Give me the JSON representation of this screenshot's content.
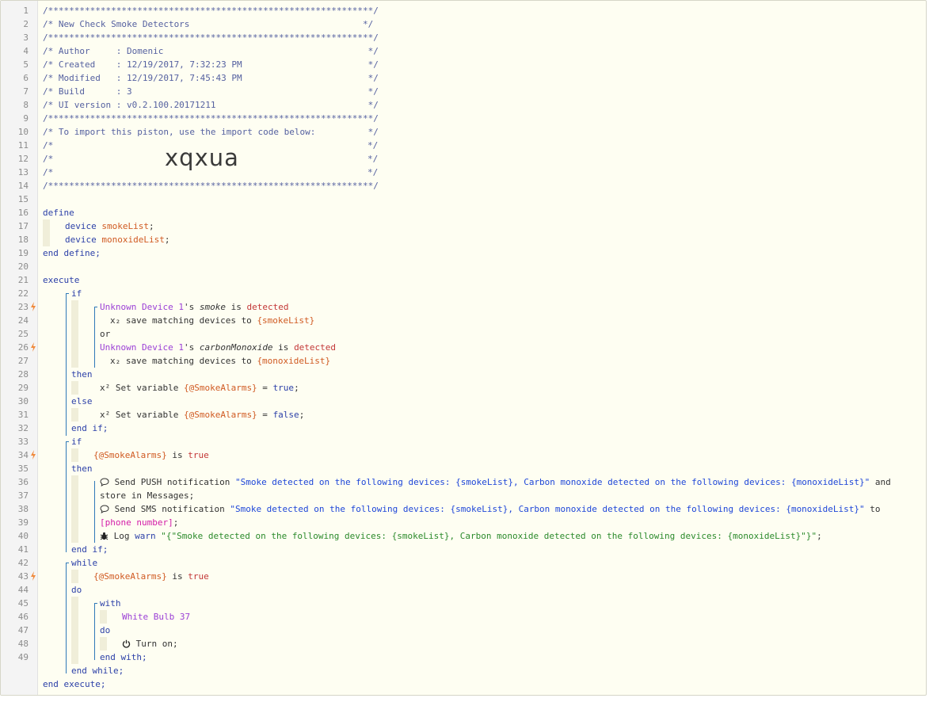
{
  "header": {
    "border_line": "/**************************************************************/",
    "title_line": "/* New Check Smoke Detectors                                 */",
    "author_line": "/* Author     : Domenic                                       */",
    "created_line": "/* Created    : 12/19/2017, 7:32:23 PM                        */",
    "modified_line": "/* Modified   : 12/19/2017, 7:45:43 PM                        */",
    "build_line": "/* Build      : 3                                             */",
    "version_line": "/* UI version : v0.2.100.20171211                             */",
    "import_line": "/* To import this piston, use the import code below:          */",
    "blank_comment_left": "/*",
    "blank_comment_right": "*/",
    "import_code": "xqxua"
  },
  "line_numbers": [
    "1",
    "2",
    "3",
    "4",
    "5",
    "6",
    "7",
    "8",
    "9",
    "10",
    "11",
    "12",
    "13",
    "14",
    "15",
    "16",
    "17",
    "18",
    "19",
    "20",
    "21",
    "22",
    "23",
    "24",
    "25",
    "26",
    "27",
    "28",
    "29",
    "30",
    "31",
    "32",
    "33",
    "34",
    "35",
    "36",
    "37",
    "38",
    "39",
    "40",
    "41",
    "42",
    "43",
    "44",
    "45",
    "46",
    "47",
    "48",
    "49"
  ],
  "code": {
    "define": "define",
    "device_kw": "device",
    "smoke_list": "smokeList",
    "monoxide_list": "monoxideList",
    "semicolon": ";",
    "end_define": "end define;",
    "execute": "execute",
    "if": "if",
    "unknown_device": "Unknown Device 1",
    "apos_s": "'s ",
    "smoke_attr": "smoke",
    "co_attr": "carbonMonoxide",
    "is": " is ",
    "detected": "detected",
    "x2_save": "x₂ save matching devices to ",
    "smoke_list_var": "{smokeList}",
    "monoxide_list_var": "{monoxideList}",
    "or": "or",
    "then": "then",
    "else": "else",
    "set_variable": "x² Set variable ",
    "smoke_alarms": "{@SmokeAlarms}",
    "equals": " = ",
    "true": "true",
    "false": "false",
    "end_if": "end if;",
    "is_true_is": " is ",
    "send_push": " Send PUSH notification ",
    "push_msg": "\"Smoke detected on the following devices: {smokeList}, Carbon monoxide detected on the following devices: {monoxideList}\"",
    "and": " and",
    "store_in": "store in Messages;",
    "send_sms": " Send SMS notification ",
    "sms_msg": "\"Smoke detected on the following devices: {smokeList}, Carbon monoxide detected on the following devices: {monoxideList}\"",
    "to": " to",
    "phone_number": "[phone number]",
    "log": " Log ",
    "warn": "warn",
    "log_msg": "\"{\"Smoke detected on the following devices: {smokeList}, Carbon monoxide detected on the following devices: {monoxideList}\"}\"",
    "while": "while",
    "do": "do",
    "with": "with",
    "white_bulb": "White Bulb 37",
    "turn_on": " Turn on;",
    "end_with": "end with;",
    "end_while": "end while;",
    "end_execute": "end execute;"
  },
  "colors": {
    "keyword": "#2c40a8",
    "device": "#9b3fd6",
    "variable": "#d05a22",
    "value": "#c33737",
    "string": "#1e46d8",
    "log_string": "#2b8a2b",
    "phone": "#d31ba8",
    "bolt": "#f08a3c",
    "bracket": "#2f79b8"
  },
  "icons": [
    "bolt-icon",
    "speech-bubble-icon",
    "bug-icon",
    "power-icon"
  ]
}
